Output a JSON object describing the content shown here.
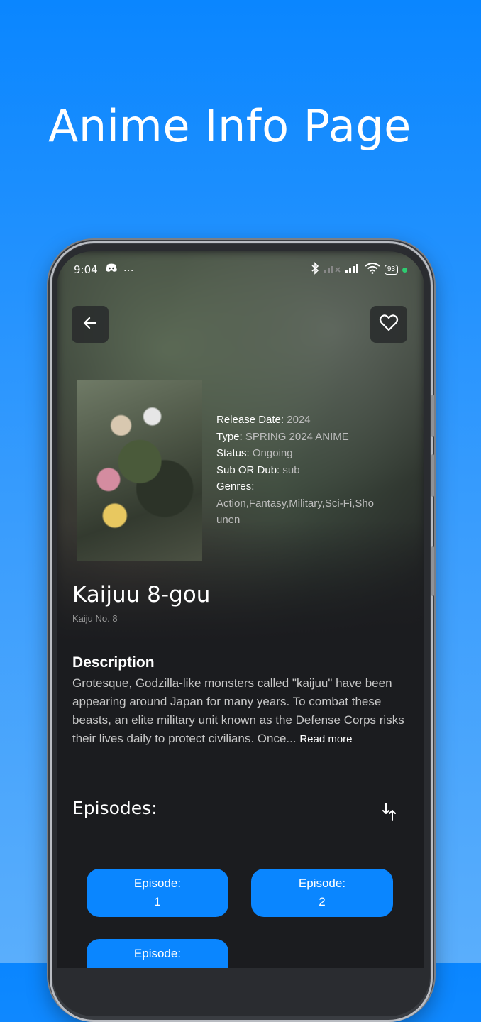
{
  "headline": "Anime Info Page",
  "status_bar": {
    "time": "9:04",
    "dots": "···",
    "battery": "93"
  },
  "anime": {
    "release_label": "Release Date:",
    "release_value": "2024",
    "type_label": "Type:",
    "type_value": "SPRING 2024 ANIME",
    "status_label": "Status:",
    "status_value": "Ongoing",
    "subdub_label": "Sub OR Dub:",
    "subdub_value": "sub",
    "genres_label": "Genres:",
    "genres_value": "Action,Fantasy,Military,Sci-Fi,Shounen",
    "title": "Kaijuu 8-gou",
    "alt_title": "Kaiju No. 8"
  },
  "description": {
    "heading": "Description",
    "text": "Grotesque, Godzilla-like monsters called \"kaijuu\" have been appearing around Japan for many years. To combat these beasts, an elite military unit known as the Defense Corps risks their lives daily to protect civilians. Once...",
    "read_more": "Read more"
  },
  "episodes": {
    "heading": "Episodes:",
    "items": [
      {
        "label": "Episode:",
        "number": "1"
      },
      {
        "label": "Episode:",
        "number": "2"
      },
      {
        "label": "Episode:",
        "number": ""
      }
    ]
  },
  "colors": {
    "accent": "#0a86ff",
    "background": "#1b1c1f",
    "page_gradient_top": "#0a86ff"
  },
  "icons": {
    "back": "arrow-left-icon",
    "favorite": "heart-icon",
    "sort": "sort-arrows-icon"
  }
}
